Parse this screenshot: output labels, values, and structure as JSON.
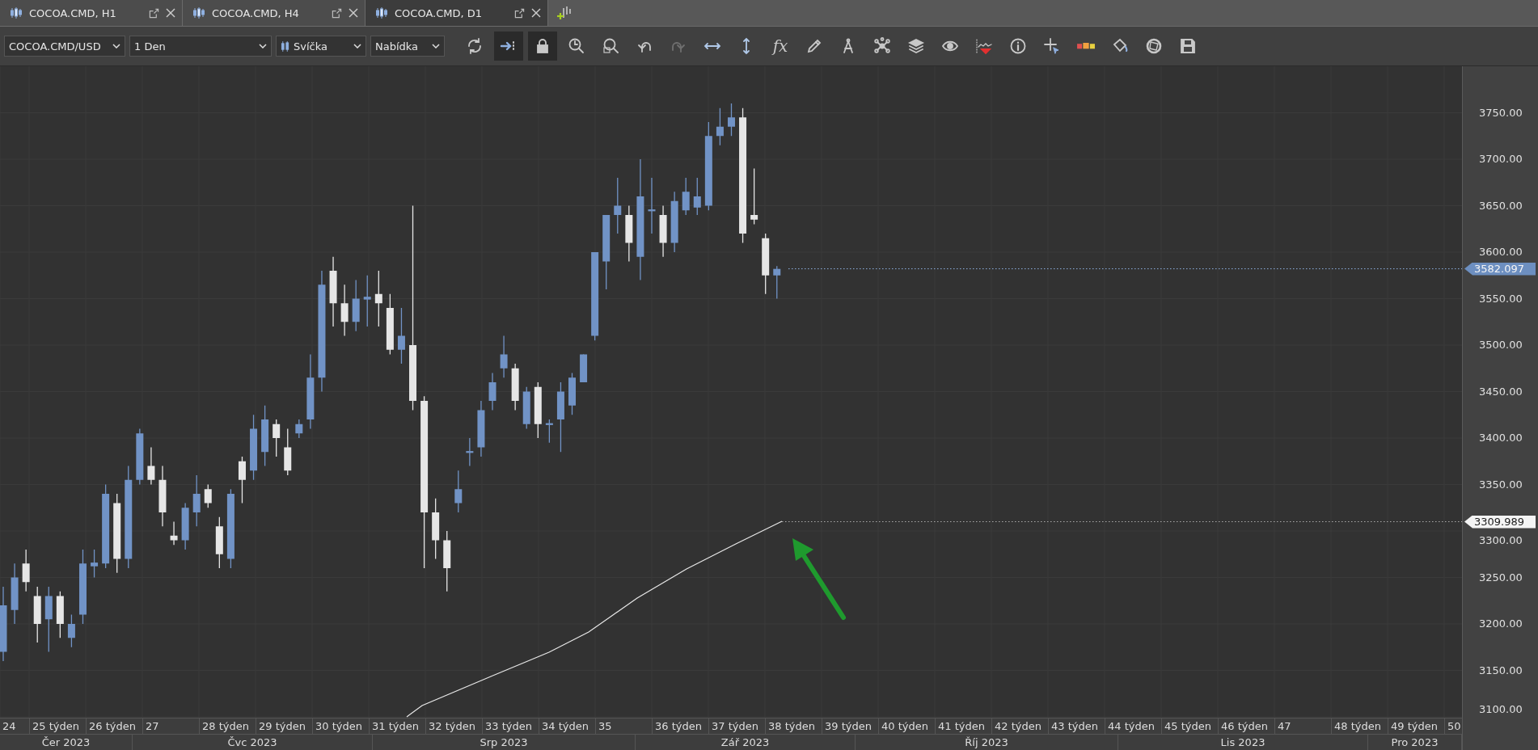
{
  "tabs": [
    {
      "label": "COCOA.CMD, H1",
      "selected": false
    },
    {
      "label": "COCOA.CMD, H4",
      "selected": false
    },
    {
      "label": "COCOA.CMD, D1",
      "selected": true
    }
  ],
  "toolbar": {
    "selects": [
      {
        "kind": "plain",
        "value": "COCOA.CMD/USD"
      },
      {
        "kind": "plain",
        "value": "1 Den"
      },
      {
        "kind": "candle",
        "value": "Svíčka"
      },
      {
        "kind": "plain",
        "value": "Nabídka"
      }
    ],
    "tools": [
      {
        "kind": "refresh",
        "selected": false,
        "disabled": false
      },
      {
        "kind": "autoscroll",
        "selected": true,
        "disabled": false
      },
      {
        "kind": "lock",
        "selected": true,
        "disabled": false
      },
      {
        "kind": "zoom-clock",
        "selected": false,
        "disabled": false
      },
      {
        "kind": "zoom-area",
        "selected": false,
        "disabled": false
      },
      {
        "kind": "undo",
        "selected": false,
        "disabled": false
      },
      {
        "kind": "redo",
        "selected": false,
        "disabled": true
      },
      {
        "kind": "h-arrows",
        "selected": false,
        "disabled": false
      },
      {
        "kind": "v-arrows",
        "selected": false,
        "disabled": false
      },
      {
        "kind": "function",
        "label": "fx",
        "selected": false,
        "disabled": false
      },
      {
        "kind": "pencil",
        "selected": false,
        "disabled": false
      },
      {
        "kind": "compass",
        "selected": false,
        "disabled": false
      },
      {
        "kind": "network",
        "selected": false,
        "disabled": false
      },
      {
        "kind": "layers",
        "selected": false,
        "disabled": false
      },
      {
        "kind": "eye",
        "selected": false,
        "disabled": false
      },
      {
        "kind": "wave",
        "selected": false,
        "disabled": false
      },
      {
        "kind": "info",
        "selected": false,
        "disabled": false
      },
      {
        "kind": "crosshair",
        "selected": false,
        "disabled": false
      },
      {
        "kind": "colorbars",
        "selected": false,
        "disabled": false
      },
      {
        "kind": "bucket",
        "selected": false,
        "disabled": false
      },
      {
        "kind": "aperture",
        "selected": false,
        "disabled": false
      },
      {
        "kind": "save",
        "selected": false,
        "disabled": false
      }
    ]
  },
  "chart": {
    "price_ticks": [
      "3750.00",
      "3700.00",
      "3650.00",
      "3600.00",
      "3550.00",
      "3500.00",
      "3450.00",
      "3400.00",
      "3350.00",
      "3300.00",
      "3250.00",
      "3200.00",
      "3150.00",
      "3100.00"
    ],
    "price_markers": [
      {
        "kind": "last",
        "value": "3582.097"
      },
      {
        "kind": "line",
        "value": "3309.989"
      }
    ],
    "week_labels": [
      "24",
      "25 týden",
      "26 týden",
      "27",
      "28 týden",
      "29 týden",
      "30 týden",
      "31 týden",
      "32 týden",
      "33 týden",
      "34 týden",
      "35",
      "36 týden",
      "37 týden",
      "38 týden",
      "39 týden",
      "40 týden",
      "41 týden",
      "42 týden",
      "43 týden",
      "44 týden",
      "45 týden",
      "46 týden",
      "47",
      "48 týden",
      "49 týden",
      "50"
    ],
    "month_labels": [
      "Čer 2023",
      "Čvc 2023",
      "Srp 2023",
      "Zář 2023",
      "Říj 2023",
      "Lis 2023",
      "Pro 2023"
    ]
  }
}
